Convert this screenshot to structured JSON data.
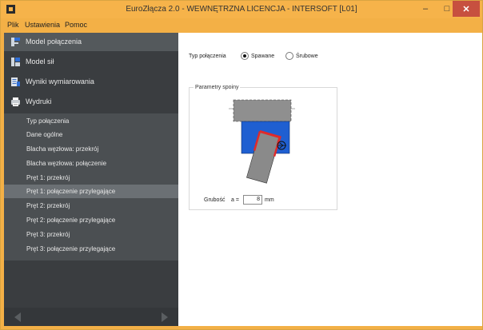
{
  "window": {
    "title": "EuroZłącza 2.0 - WEWNĘTRZNA LICENCJA - INTERSOFT [L01]",
    "minimize": "–",
    "maximize": "□",
    "close": "✕"
  },
  "menu": {
    "items": [
      "Plik",
      "Ustawienia",
      "Pomoc"
    ]
  },
  "sidebar": {
    "nav": [
      {
        "label": "Model połączenia",
        "icon": "connection-model-icon"
      },
      {
        "label": "Model sił",
        "icon": "force-model-icon"
      },
      {
        "label": "Wyniki wymiarowania",
        "icon": "results-icon"
      },
      {
        "label": "Wydruki",
        "icon": "printer-icon"
      }
    ],
    "subitems": [
      "Typ połączenia",
      "Dane ogólne",
      "Blacha węzłowa: przekrój",
      "Blacha węzłowa: połączenie",
      "Pręt 1: przekrój",
      "Pręt 1: połączenie przylegające",
      "Pręt 2: przekrój",
      "Pręt 2: połączenie przylegające",
      "Pręt 3: przekrój",
      "Pręt 3: połączenie przylegające"
    ],
    "selected_subitem": "Pręt 1: połączenie przylegające"
  },
  "main": {
    "connection_type": {
      "label": "Typ połączenia",
      "options": [
        "Spawane",
        "Śrubowe"
      ],
      "selected": "Spawane"
    },
    "weld_params": {
      "title": "Parametry spoiny",
      "thickness_label": "Grubość",
      "a_label": "a =",
      "a_value": "8",
      "unit": "mm"
    }
  },
  "colors": {
    "title_bar": "#f6b34a",
    "close_button": "#c7503f",
    "sidebar": "#3a3d40",
    "plate_blue": "#1f5fd1",
    "weld_red": "#e02a2a",
    "steel_gray": "#8f8f8f"
  }
}
